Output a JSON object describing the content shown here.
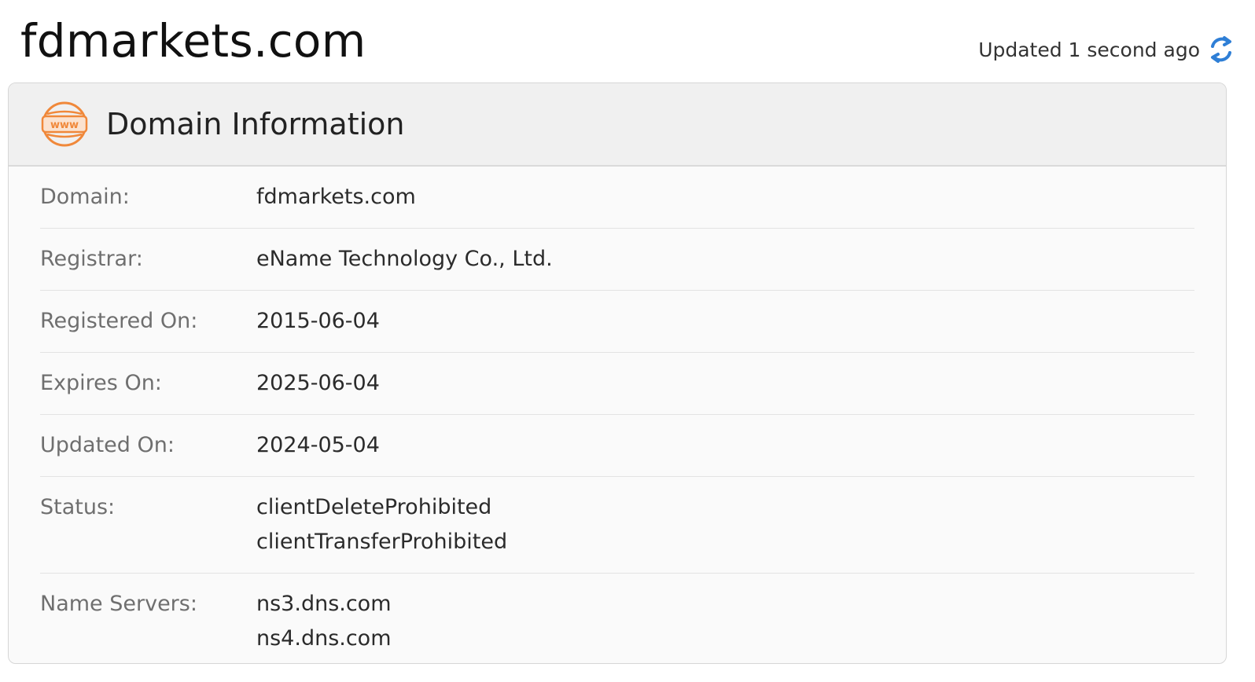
{
  "page": {
    "title": "fdmarkets.com",
    "updated_text": "Updated 1 second ago"
  },
  "card": {
    "title": "Domain Information",
    "icon": "www-globe-icon",
    "icon_color": "#f0883a"
  },
  "rows": [
    {
      "label": "Domain:",
      "values": [
        "fdmarkets.com"
      ]
    },
    {
      "label": "Registrar:",
      "values": [
        "eName Technology Co., Ltd."
      ]
    },
    {
      "label": "Registered On:",
      "values": [
        "2015-06-04"
      ]
    },
    {
      "label": "Expires On:",
      "values": [
        "2025-06-04"
      ]
    },
    {
      "label": "Updated On:",
      "values": [
        "2024-05-04"
      ]
    },
    {
      "label": "Status:",
      "values": [
        "clientDeleteProhibited",
        "clientTransferProhibited"
      ]
    },
    {
      "label": "Name Servers:",
      "values": [
        "ns3.dns.com",
        "ns4.dns.com"
      ]
    }
  ],
  "colors": {
    "refresh_icon": "#2f7fd6",
    "label_text": "#6f6f6f",
    "value_text": "#2b2b2b"
  }
}
